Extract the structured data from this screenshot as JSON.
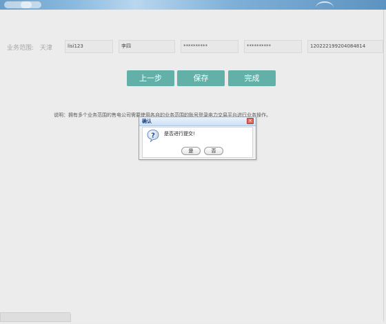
{
  "form": {
    "scope_label": "业务范围:",
    "scope_value": "天津",
    "fields": [
      "lisi123",
      "李四",
      "**********",
      "**********",
      "120222199204084814"
    ]
  },
  "buttons": {
    "prev_label": "上一步",
    "save_label": "保存",
    "finish_label": "完成"
  },
  "note": "说明：拥有多个业务范围的售电公司需要使用各自的业务范围的账号登录电力交易平台进行业务操作。",
  "dialog": {
    "title": "确认",
    "close_label": "×",
    "message": "是否进行提交!",
    "icon": "question-icon",
    "yes_label": "是",
    "no_label": "否"
  },
  "colors": {
    "accent_button": "#62b0a7",
    "background": "#ececec",
    "dialog_border": "#7fa3cf"
  }
}
